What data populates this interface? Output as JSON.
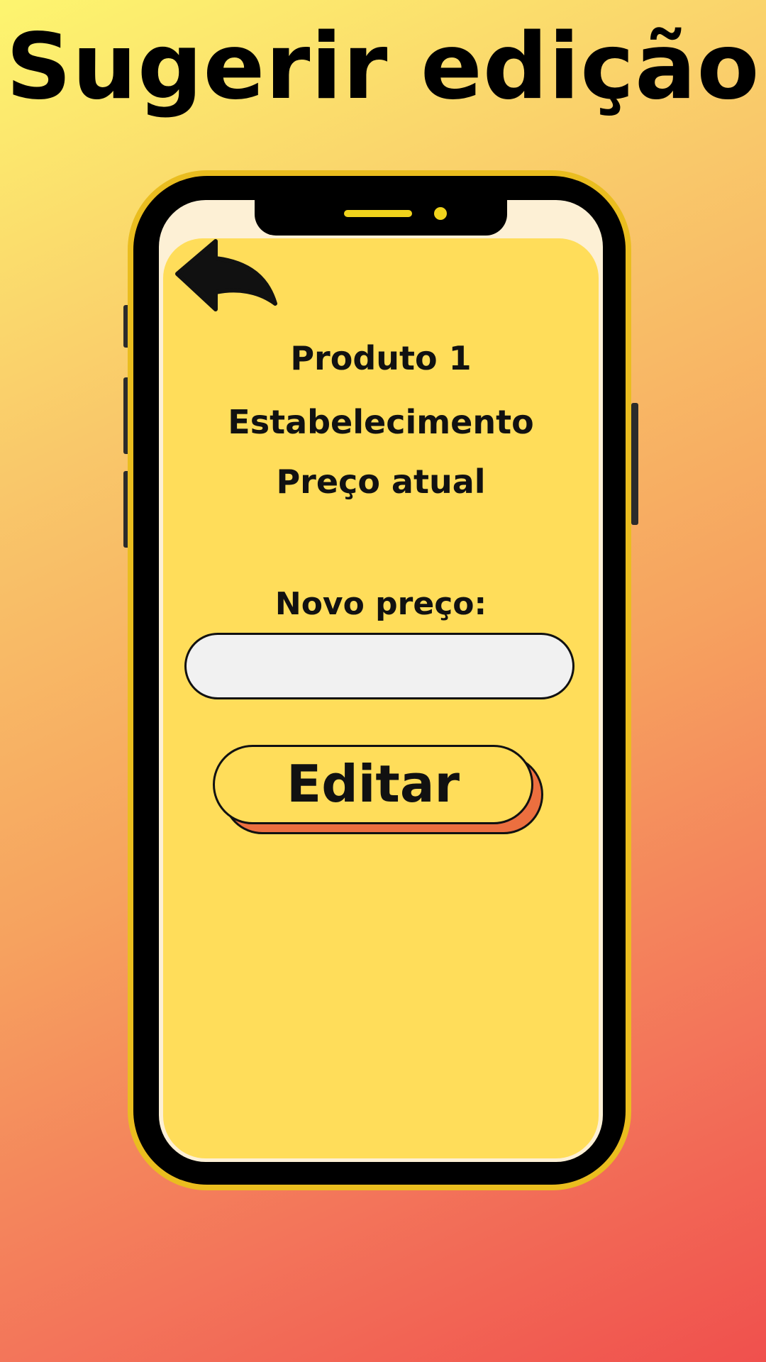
{
  "header": {
    "title": "Sugerir edição"
  },
  "product": {
    "name": "Produto 1",
    "store": "Estabelecimento",
    "current_price_label": "Preço atual"
  },
  "form": {
    "new_price_label": "Novo preço:",
    "new_price_value": "",
    "submit_label": "Editar"
  },
  "icons": {
    "back": "back-arrow-icon"
  },
  "colors": {
    "screen": "#ffdd5a",
    "phone_frame": "#000000",
    "phone_trim": "#eabd1f",
    "button_shadow": "#ec6f3f",
    "input_fill": "#f1f1f1"
  }
}
